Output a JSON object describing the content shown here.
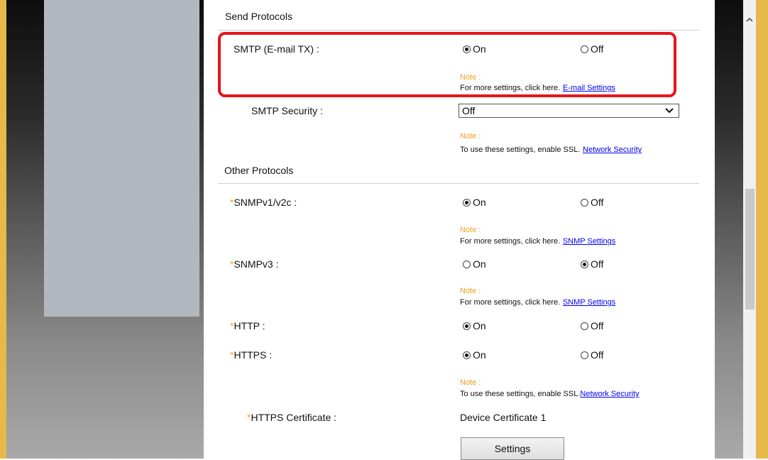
{
  "colors": {
    "frame": "#e9b84a",
    "highlight": "#e8141b",
    "note": "#f0a020",
    "link": "#0000ee"
  },
  "send_protocols": {
    "title": "Send Protocols",
    "smtp": {
      "label": "SMTP (E-mail TX) :",
      "on_label": "On",
      "off_label": "Off",
      "selected": "On",
      "note_title": "Note :",
      "note_text": "For more settings, click here.",
      "note_link": "E-mail Settings"
    },
    "smtp_security": {
      "label": "SMTP Security :",
      "value": "Off",
      "note_title": "Note :",
      "note_text": "To use these settings, enable SSL.",
      "note_link": "Network Security"
    }
  },
  "other_protocols": {
    "title": "Other Protocols",
    "snmpv1": {
      "label": "SNMPv1/v2c :",
      "on_label": "On",
      "off_label": "Off",
      "selected": "On",
      "note_title": "Note :",
      "note_text": "For more settings, click here.",
      "note_link": "SNMP Settings"
    },
    "snmpv3": {
      "label": "SNMPv3 :",
      "on_label": "On",
      "off_label": "Off",
      "selected": "Off",
      "note_title": "Note :",
      "note_text": "For more settings, click here.",
      "note_link": "SNMP Settings"
    },
    "http": {
      "label": "HTTP :",
      "on_label": "On",
      "off_label": "Off",
      "selected": "On"
    },
    "https": {
      "label": "HTTPS :",
      "on_label": "On",
      "off_label": "Off",
      "selected": "On",
      "note_title": "Note :",
      "note_text": "To use these settings, enable SSL.",
      "note_link": "Network Security"
    },
    "https_certificate": {
      "label": "HTTPS Certificate :",
      "value": "Device Certificate 1",
      "button": "Settings"
    },
    "required_mark": "*"
  },
  "icons": {
    "scroll_up": "chevron-up-icon",
    "dropdown": "chevron-down-icon"
  }
}
